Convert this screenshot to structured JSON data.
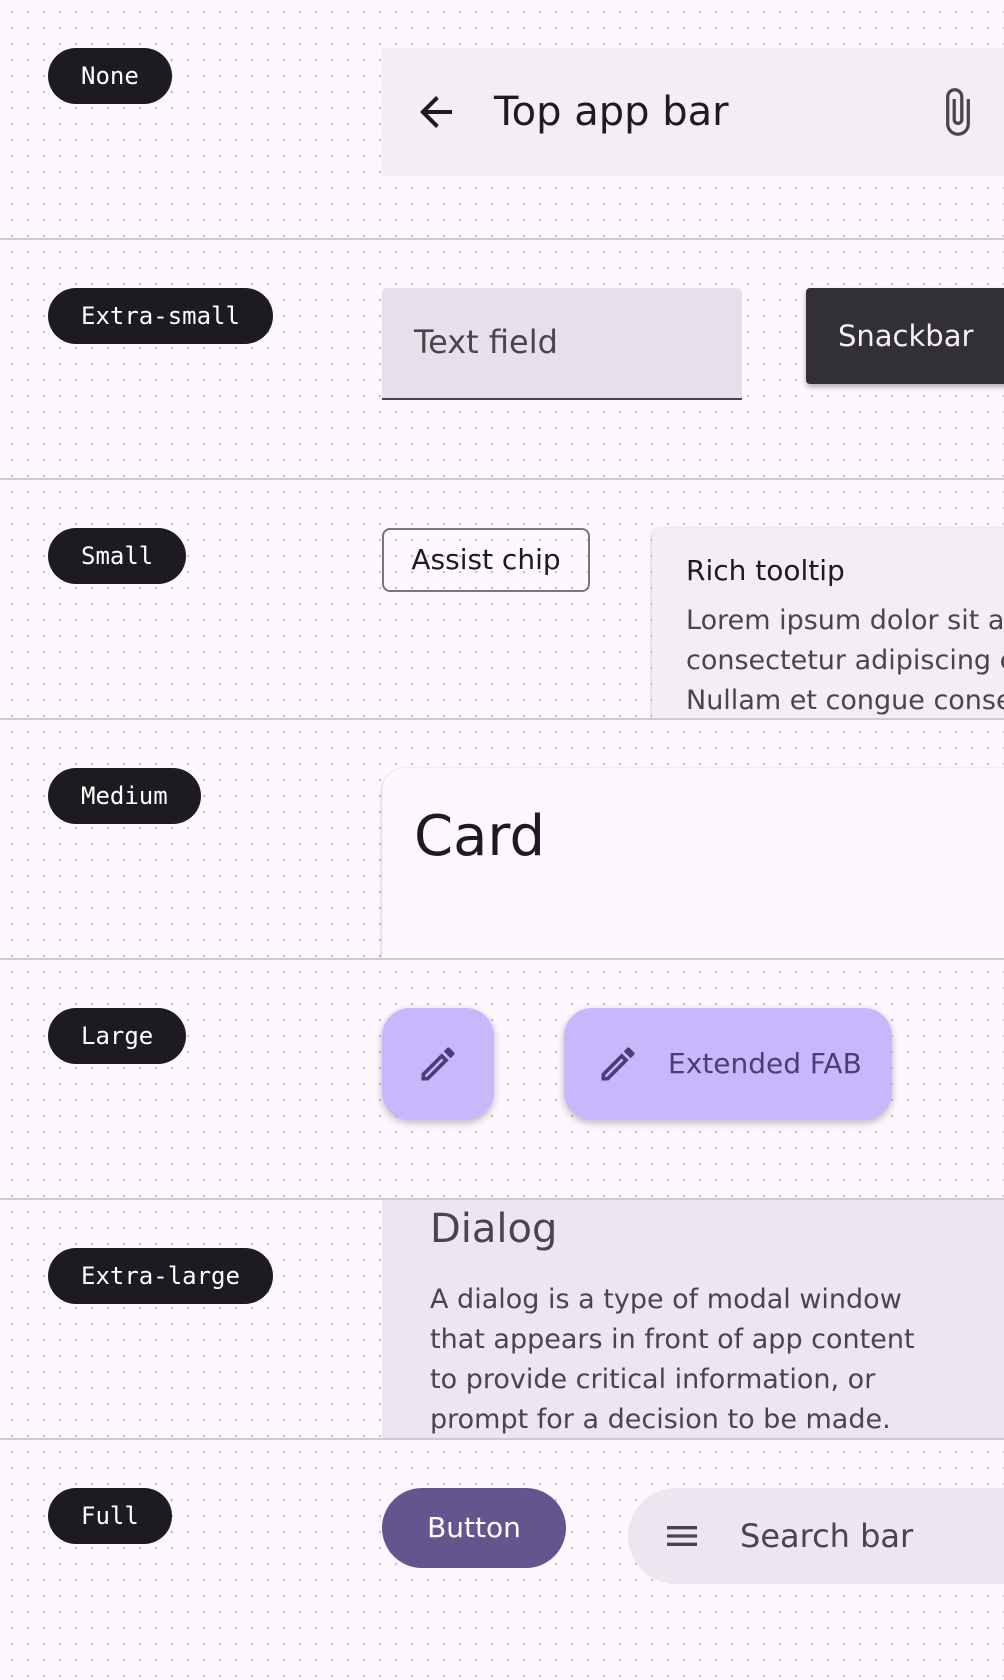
{
  "shape_labels": {
    "none": "None",
    "extra_small": "Extra-small",
    "small": "Small",
    "medium": "Medium",
    "large": "Large",
    "extra_large": "Extra-large",
    "full": "Full"
  },
  "top_app_bar": {
    "title": "Top app bar",
    "leading_icon": "arrow-back-icon",
    "trailing_icon": "attach-file-icon"
  },
  "text_field": {
    "label": "Text field"
  },
  "snackbar": {
    "text": "Snackbar"
  },
  "assist_chip": {
    "label": "Assist chip"
  },
  "rich_tooltip": {
    "title": "Rich tooltip",
    "body": "Lorem ipsum dolor sit amet, consectetur adipiscing elit. Nullam et congue consectetur. Vivamus"
  },
  "card": {
    "title": "Card"
  },
  "fab": {
    "icon": "edit-icon"
  },
  "extended_fab": {
    "label": "Extended FAB",
    "icon": "edit-icon"
  },
  "dialog": {
    "title": "Dialog",
    "body": "A dialog is a type of modal window that appears in front of app content to provide critical information, or prompt for a decision to be made."
  },
  "button": {
    "label": "Button"
  },
  "search_bar": {
    "placeholder": "Search bar",
    "icon": "menu-icon"
  },
  "colors": {
    "background": "#fdf7fe",
    "label_pill": "#1d1b20",
    "primary": "#65558f",
    "fab_container": "#c8b7fb",
    "surface_container": "#f3edf6",
    "snackbar": "#322f35"
  }
}
